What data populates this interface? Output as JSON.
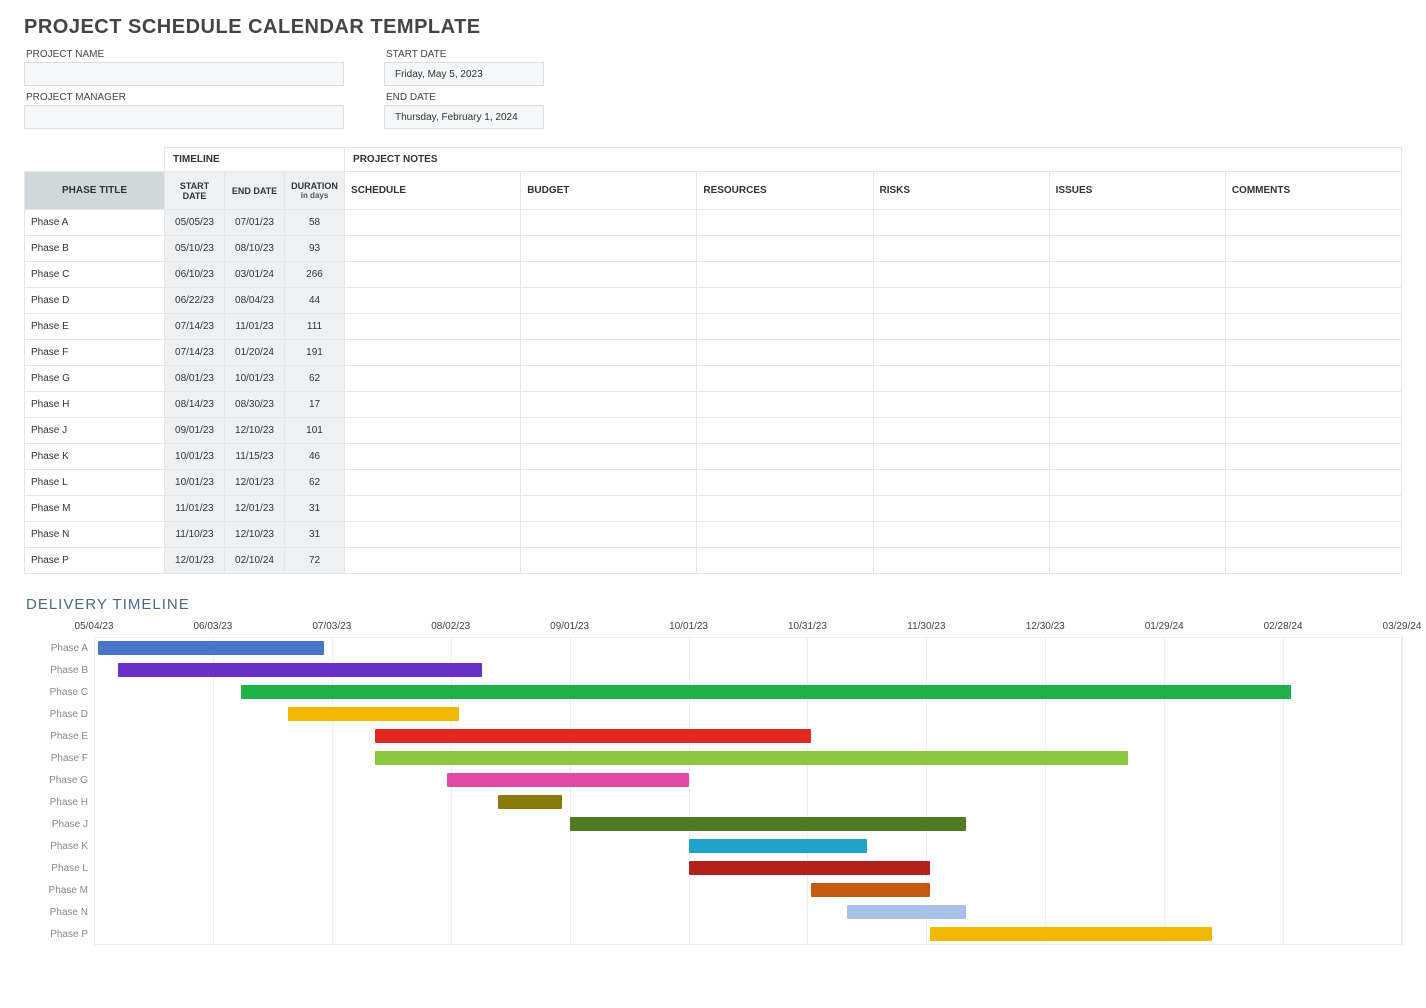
{
  "title": "PROJECT SCHEDULE CALENDAR TEMPLATE",
  "meta": {
    "project_name_label": "PROJECT NAME",
    "project_manager_label": "PROJECT MANAGER",
    "start_date_label": "START DATE",
    "end_date_label": "END DATE",
    "start_date_value": "Friday, May 5, 2023",
    "end_date_value": "Thursday, February 1, 2024"
  },
  "table": {
    "group_timeline": "TIMELINE",
    "group_notes": "PROJECT NOTES",
    "col_phase": "PHASE TITLE",
    "col_start": "START DATE",
    "col_end": "END DATE",
    "col_dur": "DURATION",
    "col_dur_sub": "in days",
    "col_schedule": "SCHEDULE",
    "col_budget": "BUDGET",
    "col_resources": "RESOURCES",
    "col_risks": "RISKS",
    "col_issues": "ISSUES",
    "col_comments": "COMMENTS"
  },
  "phases": [
    {
      "name": "Phase A",
      "start": "05/05/23",
      "end": "07/01/23",
      "dur": "58"
    },
    {
      "name": "Phase B",
      "start": "05/10/23",
      "end": "08/10/23",
      "dur": "93"
    },
    {
      "name": "Phase C",
      "start": "06/10/23",
      "end": "03/01/24",
      "dur": "266"
    },
    {
      "name": "Phase D",
      "start": "06/22/23",
      "end": "08/04/23",
      "dur": "44"
    },
    {
      "name": "Phase E",
      "start": "07/14/23",
      "end": "11/01/23",
      "dur": "111"
    },
    {
      "name": "Phase F",
      "start": "07/14/23",
      "end": "01/20/24",
      "dur": "191"
    },
    {
      "name": "Phase G",
      "start": "08/01/23",
      "end": "10/01/23",
      "dur": "62"
    },
    {
      "name": "Phase H",
      "start": "08/14/23",
      "end": "08/30/23",
      "dur": "17"
    },
    {
      "name": "Phase J",
      "start": "09/01/23",
      "end": "12/10/23",
      "dur": "101"
    },
    {
      "name": "Phase K",
      "start": "10/01/23",
      "end": "11/15/23",
      "dur": "46"
    },
    {
      "name": "Phase L",
      "start": "10/01/23",
      "end": "12/01/23",
      "dur": "62"
    },
    {
      "name": "Phase M",
      "start": "11/01/23",
      "end": "12/01/23",
      "dur": "31"
    },
    {
      "name": "Phase N",
      "start": "11/10/23",
      "end": "12/10/23",
      "dur": "31"
    },
    {
      "name": "Phase P",
      "start": "12/01/23",
      "end": "02/10/24",
      "dur": "72"
    }
  ],
  "timeline_hdr": "DELIVERY TIMELINE",
  "chart_data": {
    "type": "bar",
    "title": "DELIVERY TIMELINE",
    "x_ticks": [
      "05/04/23",
      "06/03/23",
      "07/03/23",
      "08/02/23",
      "09/01/23",
      "10/01/23",
      "10/31/23",
      "11/30/23",
      "12/30/23",
      "01/29/24",
      "02/28/24",
      "03/29/24"
    ],
    "x_range_days": {
      "start": "2023-05-04",
      "end": "2024-03-29",
      "total": 330
    },
    "series": [
      {
        "name": "Phase A",
        "start": "2023-05-05",
        "end": "2023-07-01",
        "color": "#4a76c7"
      },
      {
        "name": "Phase B",
        "start": "2023-05-10",
        "end": "2023-08-10",
        "color": "#6a2fc9"
      },
      {
        "name": "Phase C",
        "start": "2023-06-10",
        "end": "2024-03-01",
        "color": "#1fb24a"
      },
      {
        "name": "Phase D",
        "start": "2023-06-22",
        "end": "2023-08-04",
        "color": "#f2b900"
      },
      {
        "name": "Phase E",
        "start": "2023-07-14",
        "end": "2023-11-01",
        "color": "#e02a1f"
      },
      {
        "name": "Phase F",
        "start": "2023-07-14",
        "end": "2024-01-20",
        "color": "#8bc83e"
      },
      {
        "name": "Phase G",
        "start": "2023-08-01",
        "end": "2023-10-01",
        "color": "#e24aa8"
      },
      {
        "name": "Phase H",
        "start": "2023-08-14",
        "end": "2023-08-30",
        "color": "#8a7a0a"
      },
      {
        "name": "Phase J",
        "start": "2023-09-01",
        "end": "2023-12-10",
        "color": "#4f7a1f"
      },
      {
        "name": "Phase K",
        "start": "2023-10-01",
        "end": "2023-11-15",
        "color": "#1fa3c9"
      },
      {
        "name": "Phase L",
        "start": "2023-10-01",
        "end": "2023-12-01",
        "color": "#b2201a"
      },
      {
        "name": "Phase M",
        "start": "2023-11-01",
        "end": "2023-12-01",
        "color": "#c65a11"
      },
      {
        "name": "Phase N",
        "start": "2023-11-10",
        "end": "2023-12-10",
        "color": "#a8c2e6"
      },
      {
        "name": "Phase P",
        "start": "2023-12-01",
        "end": "2024-02-10",
        "color": "#f2b900"
      }
    ]
  }
}
